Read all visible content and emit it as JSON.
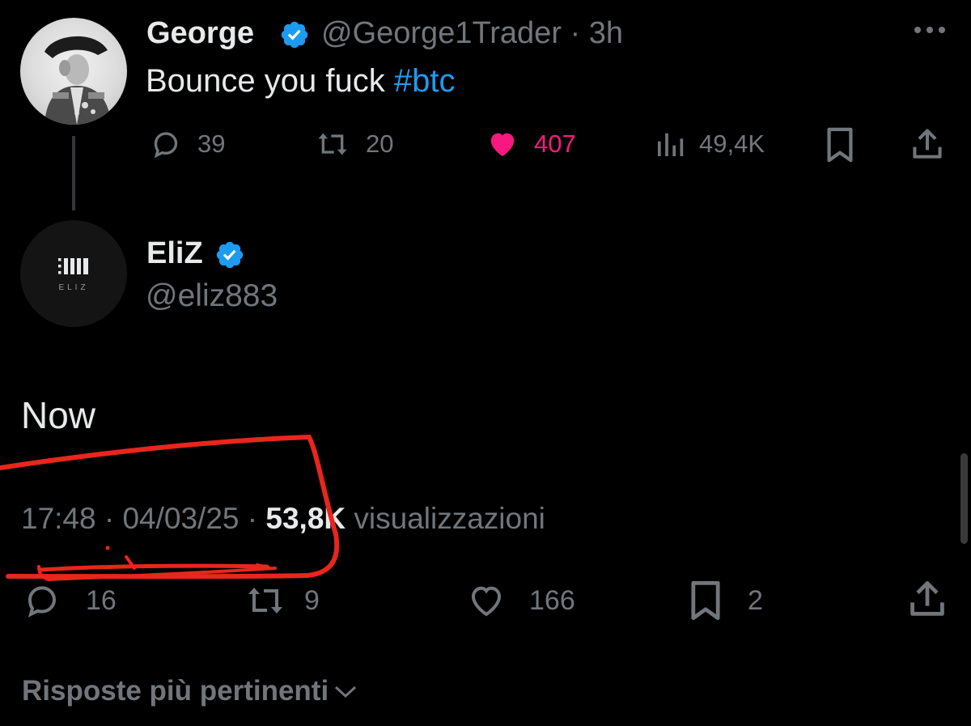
{
  "parent": {
    "name": "George",
    "handle_time": "@George1Trader · 3h",
    "text_plain": "Bounce you fuck ",
    "hashtag": "#btc",
    "actions": {
      "replies": "39",
      "reposts": "20",
      "likes": "407",
      "views": "49,4K"
    }
  },
  "reply": {
    "name": "EliZ",
    "handle": "@eliz883",
    "avatar_text": "ELIZ",
    "text": "Now",
    "meta": {
      "time_date": "17:48 · 04/03/25 · ",
      "views_count": "53,8K",
      "views_label": " visualizzazioni"
    },
    "actions": {
      "replies": "16",
      "reposts": "9",
      "likes": "166",
      "bookmarks": "2"
    }
  },
  "sort": {
    "label": "Risposte più pertinenti"
  },
  "colors": {
    "background": "#000000",
    "text": "#e7e9ea",
    "muted": "#71767b",
    "accent": "#1d9bf0",
    "like": "#f91880",
    "annotation": "#e8261c"
  }
}
